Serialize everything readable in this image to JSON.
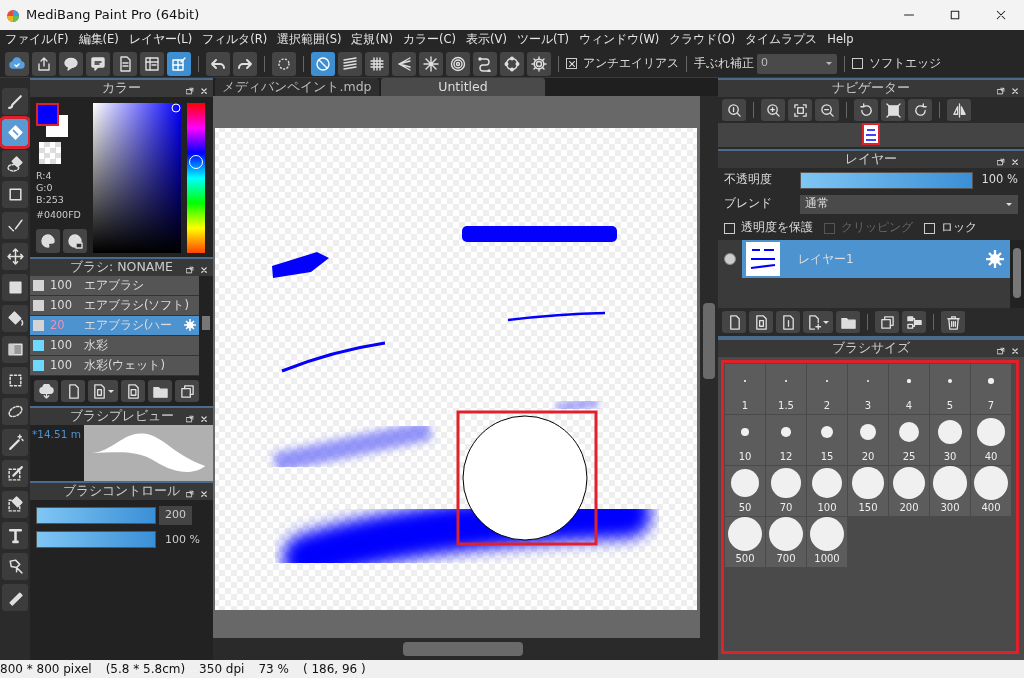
{
  "window": {
    "title": "MediBang Paint Pro (64bit)"
  },
  "menu": [
    "ファイル(F)",
    "編集(E)",
    "レイヤー(L)",
    "フィルタ(R)",
    "選択範囲(S)",
    "定規(N)",
    "カラー(C)",
    "表示(V)",
    "ツール(T)",
    "ウィンドウ(W)",
    "クラウド(O)",
    "タイムラプス",
    "Help"
  ],
  "toolbar": [
    {
      "selected": false
    },
    {
      "selected": false
    },
    {
      "selected": false
    },
    {
      "selected": false
    },
    {
      "selected": false
    },
    {
      "selected": false
    },
    {
      "selected": true
    },
    {
      "selected": false
    },
    {
      "selected": false
    },
    {
      "selected": false
    },
    {
      "selected": true
    },
    {
      "selected": false
    },
    {
      "selected": false
    },
    {
      "selected": false
    },
    {
      "selected": false
    },
    {
      "selected": false
    },
    {
      "selected": false
    },
    {
      "selected": false
    },
    {
      "selected": false
    }
  ],
  "antialias": {
    "label": "アンチエイリアス",
    "checked": true
  },
  "stabilizer": {
    "label": "手ぶれ補正",
    "value": "0"
  },
  "soft_edge": {
    "label": "ソフトエッジ",
    "checked": false
  },
  "tools": [
    {
      "selected": false,
      "highlighted": false
    },
    {
      "selected": true,
      "highlighted": true
    },
    {
      "selected": false,
      "highlighted": false
    },
    {
      "selected": false,
      "highlighted": false
    },
    {
      "selected": false,
      "highlighted": false
    },
    {
      "selected": false,
      "highlighted": false
    },
    {
      "selected": false,
      "highlighted": false
    },
    {
      "selected": false,
      "highlighted": false
    },
    {
      "selected": false,
      "highlighted": false
    },
    {
      "selected": false,
      "highlighted": false
    },
    {
      "selected": false,
      "highlighted": false
    },
    {
      "selected": false,
      "highlighted": false
    },
    {
      "selected": false,
      "highlighted": false
    },
    {
      "selected": false,
      "highlighted": false
    },
    {
      "selected": false,
      "highlighted": false
    },
    {
      "selected": false,
      "highlighted": false
    },
    {
      "selected": false,
      "highlighted": false
    }
  ],
  "color_panel": {
    "title": "カラー",
    "readings": [
      "R:4",
      "G:0",
      "B:253",
      "#0400FD"
    ]
  },
  "brush_panel": {
    "title": "ブラシ: NONAME",
    "items": [
      {
        "size": "100",
        "name": "エアブラシ",
        "color": "#d4d4d4",
        "selected": false
      },
      {
        "size": "100",
        "name": "エアブラシ(ソフト)",
        "color": "#d4d4d4",
        "selected": false
      },
      {
        "size": "20",
        "name": "エアブラシ(ハー",
        "color": "#d4d4d4",
        "selected": true
      },
      {
        "size": "100",
        "name": "水彩",
        "color": "#6fd8ff",
        "selected": false
      },
      {
        "size": "100",
        "name": "水彩(ウェット)",
        "color": "#6fd8ff",
        "selected": false
      }
    ]
  },
  "brush_preview": {
    "title": "ブラシプレビュー",
    "size": "*14.51 m"
  },
  "brush_control": {
    "title": "ブラシコントロール",
    "size": {
      "level": 1,
      "reading": "200"
    },
    "opacity": {
      "level": 1,
      "reading": "100 %"
    }
  },
  "document_tabs": [
    {
      "label": "メディバンペイント.mdp",
      "selected": false
    },
    {
      "label": "Untitled",
      "selected": true
    }
  ],
  "canvas": {
    "brush_cursor": true,
    "highlighted": true
  },
  "navigator": {
    "title": "ナビゲーター"
  },
  "layer_panel": {
    "title": "レイヤー",
    "opacity_label": "不透明度",
    "opacity": {
      "level": 1,
      "reading": "100 %"
    },
    "blend_label": "ブレンド",
    "blend": "通常",
    "options": [
      {
        "label": "透明度を保護",
        "checked": false,
        "disabled": false
      },
      {
        "label": "クリッピング",
        "checked": false,
        "disabled": true
      },
      {
        "label": "ロック",
        "checked": false,
        "disabled": false
      }
    ],
    "layers": [
      {
        "name": "レイヤー1",
        "selected": true,
        "visible": true
      }
    ]
  },
  "brush_size": {
    "title": "ブラシサイズ",
    "highlighted": true,
    "sizes": [
      "1",
      "1.5",
      "2",
      "3",
      "4",
      "5",
      "7",
      "10",
      "12",
      "15",
      "20",
      "25",
      "30",
      "40",
      "50",
      "70",
      "100",
      "150",
      "200",
      "300",
      "400",
      "500",
      "700",
      "1000"
    ]
  },
  "status_bar": [
    "800 * 800 pixel",
    "(5.8 * 5.8cm)",
    "350 dpi",
    "73 %",
    "( 186, 96 )"
  ]
}
